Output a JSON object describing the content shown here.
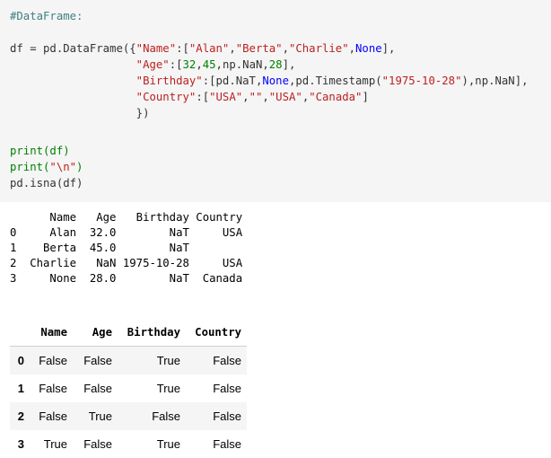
{
  "code": {
    "lines": [
      [
        {
          "t": "#DataFrame:",
          "c": "c"
        }
      ],
      [],
      [
        {
          "t": "df = pd.DataFrame({",
          "c": "pn"
        },
        {
          "t": "\"Name\"",
          "c": "s"
        },
        {
          "t": ":[",
          "c": "pn"
        },
        {
          "t": "\"Alan\"",
          "c": "s"
        },
        {
          "t": ",",
          "c": "pn"
        },
        {
          "t": "\"Berta\"",
          "c": "s"
        },
        {
          "t": ",",
          "c": "pn"
        },
        {
          "t": "\"Charlie\"",
          "c": "s"
        },
        {
          "t": ",",
          "c": "pn"
        },
        {
          "t": "None",
          "c": "k"
        },
        {
          "t": "],",
          "c": "pn"
        }
      ],
      [
        {
          "t": "                   ",
          "c": "pn"
        },
        {
          "t": "\"Age\"",
          "c": "s"
        },
        {
          "t": ":[",
          "c": "pn"
        },
        {
          "t": "32",
          "c": "n"
        },
        {
          "t": ",",
          "c": "pn"
        },
        {
          "t": "45",
          "c": "n"
        },
        {
          "t": ",np.NaN,",
          "c": "pn"
        },
        {
          "t": "28",
          "c": "n"
        },
        {
          "t": "],",
          "c": "pn"
        }
      ],
      [
        {
          "t": "                   ",
          "c": "pn"
        },
        {
          "t": "\"Birthday\"",
          "c": "s"
        },
        {
          "t": ":[pd.NaT,",
          "c": "pn"
        },
        {
          "t": "None",
          "c": "k"
        },
        {
          "t": ",pd.Timestamp(",
          "c": "pn"
        },
        {
          "t": "\"1975-10-28\"",
          "c": "s"
        },
        {
          "t": "),np.NaN],",
          "c": "pn"
        }
      ],
      [
        {
          "t": "                   ",
          "c": "pn"
        },
        {
          "t": "\"Country\"",
          "c": "s"
        },
        {
          "t": ":[",
          "c": "pn"
        },
        {
          "t": "\"USA\"",
          "c": "s"
        },
        {
          "t": ",",
          "c": "pn"
        },
        {
          "t": "\"\"",
          "c": "s"
        },
        {
          "t": ",",
          "c": "pn"
        },
        {
          "t": "\"USA\"",
          "c": "s"
        },
        {
          "t": ",",
          "c": "pn"
        },
        {
          "t": "\"Canada\"",
          "c": "s"
        },
        {
          "t": "]",
          "c": "pn"
        }
      ],
      [
        {
          "t": "                   })",
          "c": "pn"
        }
      ],
      [],
      [
        {
          "t": "print(df)",
          "c": "n"
        }
      ],
      [
        {
          "t": "print(",
          "c": "n"
        },
        {
          "t": "\"\\n\"",
          "c": "s"
        },
        {
          "t": ")",
          "c": "n"
        }
      ],
      [
        {
          "t": "pd.isna(df)",
          "c": "pn"
        }
      ]
    ]
  },
  "text_output": "      Name   Age   Birthday Country\n0     Alan  32.0        NaT     USA\n1    Berta  45.0        NaT        \n2  Charlie   NaN 1975-10-28     USA\n3     None  28.0        NaT  Canada",
  "df_table": {
    "columns": [
      "",
      "Name",
      "Age",
      "Birthday",
      "Country"
    ],
    "rows": [
      {
        "index": "0",
        "cells": [
          "False",
          "False",
          "True",
          "False"
        ]
      },
      {
        "index": "1",
        "cells": [
          "False",
          "False",
          "True",
          "False"
        ]
      },
      {
        "index": "2",
        "cells": [
          "False",
          "True",
          "False",
          "False"
        ]
      },
      {
        "index": "3",
        "cells": [
          "True",
          "False",
          "True",
          "False"
        ]
      }
    ]
  },
  "colors": {
    "code_bg": "#f5f5f5",
    "comment": "#408080",
    "string": "#ba2121",
    "number": "#008000",
    "keyword": "#0000ff"
  }
}
